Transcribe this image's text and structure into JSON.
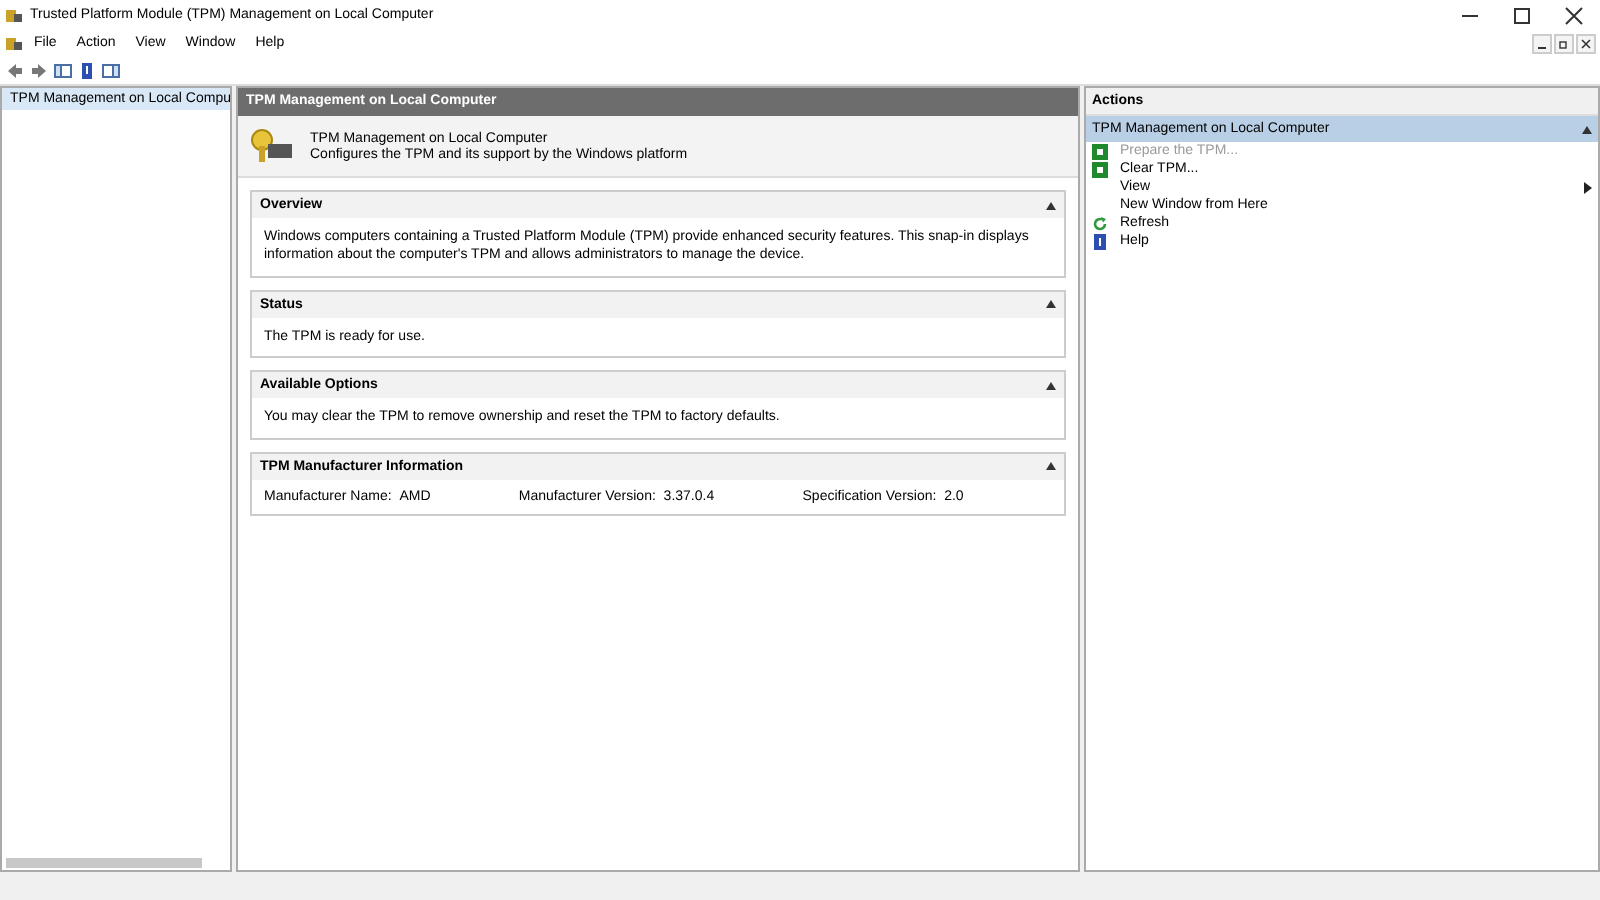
{
  "window": {
    "title": "Trusted Platform Module (TPM) Management on Local Computer"
  },
  "menu": [
    "File",
    "Action",
    "View",
    "Window",
    "Help"
  ],
  "tree": {
    "items": [
      {
        "label": "TPM Management on Local Compu",
        "selected": true
      }
    ]
  },
  "main": {
    "header": "TPM Management on Local Computer",
    "intro": {
      "title": "TPM Management on Local Computer",
      "subtitle": "Configures the TPM and its support by the Windows platform"
    },
    "sections": [
      {
        "title": "Overview",
        "expanded": true,
        "text": "Windows computers containing a Trusted Platform Module (TPM) provide enhanced security features. This snap-in displays information about the computer's TPM and allows administrators to manage the device."
      },
      {
        "title": "Status",
        "expanded": true,
        "text": "The TPM is ready for use."
      },
      {
        "title": "Available Options",
        "expanded": true,
        "text": "You may clear the TPM to remove ownership and reset the TPM to factory defaults."
      },
      {
        "title": "TPM Manufacturer Information",
        "expanded": true,
        "fields": [
          {
            "label": "Manufacturer Name:",
            "value": "AMD"
          },
          {
            "label": "Manufacturer Version:",
            "value": "3.37.0.4"
          },
          {
            "label": "Specification Version:",
            "value": "2.0"
          }
        ]
      }
    ]
  },
  "actions": {
    "title": "Actions",
    "group": "TPM Management on Local Computer",
    "items": [
      {
        "label": "Prepare the TPM...",
        "kind": "tpm",
        "disabled": true
      },
      {
        "label": "Clear TPM...",
        "kind": "tpm",
        "disabled": false
      },
      {
        "label": "View",
        "kind": "submenu",
        "disabled": false
      },
      {
        "label": "New Window from Here",
        "kind": "plain",
        "disabled": false
      },
      {
        "label": "Refresh",
        "kind": "refresh",
        "disabled": false
      },
      {
        "label": "Help",
        "kind": "help",
        "disabled": false
      }
    ]
  }
}
